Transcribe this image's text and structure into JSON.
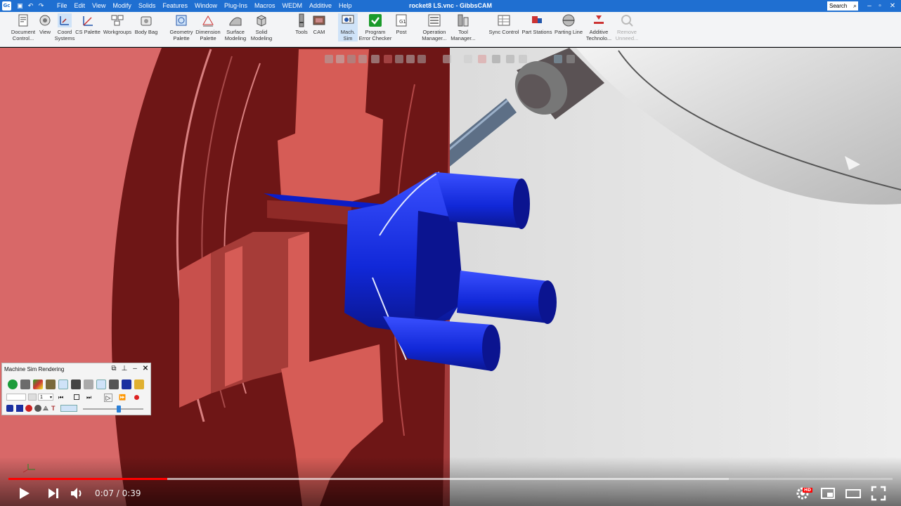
{
  "window": {
    "title": "rocket8 LS.vnc - GibbsCAM",
    "app_icon_text": "Gc",
    "search_label": "Search",
    "accent_color": "#1f6fd1"
  },
  "menu": [
    "File",
    "Edit",
    "View",
    "Modify",
    "Solids",
    "Features",
    "Window",
    "Plug-Ins",
    "Macros",
    "WEDM",
    "Additive",
    "Help"
  ],
  "ribbon": [
    {
      "label1": "Document",
      "label2": "Control...",
      "icon": "document-control-icon"
    },
    {
      "label1": "View",
      "label2": "",
      "icon": "view-icon"
    },
    {
      "label1": "Coord",
      "label2": "Systems",
      "icon": "coord-systems-icon"
    },
    {
      "label1": "CS Palette",
      "label2": "",
      "icon": "cs-palette-icon"
    },
    {
      "label1": "Workgroups",
      "label2": "",
      "icon": "workgroups-icon"
    },
    {
      "label1": "Body Bag",
      "label2": "",
      "icon": "body-bag-icon"
    },
    {
      "label1": "Geometry",
      "label2": "Palette",
      "icon": "geometry-palette-icon"
    },
    {
      "label1": "Dimension",
      "label2": "Palette",
      "icon": "dimension-palette-icon"
    },
    {
      "label1": "Surface",
      "label2": "Modeling",
      "icon": "surface-modeling-icon"
    },
    {
      "label1": "Solid",
      "label2": "Modeling",
      "icon": "solid-modeling-icon"
    },
    {
      "label1": "Tools",
      "label2": "",
      "icon": "tools-icon"
    },
    {
      "label1": "CAM",
      "label2": "",
      "icon": "cam-icon"
    },
    {
      "label1": "Mach.",
      "label2": "Sim",
      "icon": "machine-sim-icon"
    },
    {
      "label1": "Program",
      "label2": "Error Checker",
      "icon": "program-error-checker-icon"
    },
    {
      "label1": "Post",
      "label2": "",
      "icon": "post-icon"
    },
    {
      "label1": "Operation",
      "label2": "Manager...",
      "icon": "operation-manager-icon"
    },
    {
      "label1": "Tool",
      "label2": "Manager...",
      "icon": "tool-manager-icon"
    },
    {
      "label1": "Sync Control",
      "label2": "",
      "icon": "sync-control-icon"
    },
    {
      "label1": "Part Stations",
      "label2": "",
      "icon": "part-stations-icon"
    },
    {
      "label1": "Parting Line",
      "label2": "",
      "icon": "parting-line-icon"
    },
    {
      "label1": "Additive",
      "label2": "Technolo...",
      "icon": "additive-technology-icon"
    },
    {
      "label1": "Remove",
      "label2": "Unneed...",
      "icon": "remove-unneeded-icon"
    }
  ],
  "sim_panel": {
    "title": "Machine Sim Rendering",
    "speed_value": "1",
    "speed_level": 0.6
  },
  "video": {
    "time": "0:07 / 0:39",
    "current_seconds": 7,
    "total_seconds": 39,
    "buffered_fraction": 0.815,
    "hd_badge": "HD",
    "progress_color": "#ff0000"
  },
  "scene": {
    "chuck_color": "#8a1c1c",
    "jaw_color": "#e0645e",
    "part_color": "#1a2fe0",
    "background_color": "#e6e6e6"
  }
}
